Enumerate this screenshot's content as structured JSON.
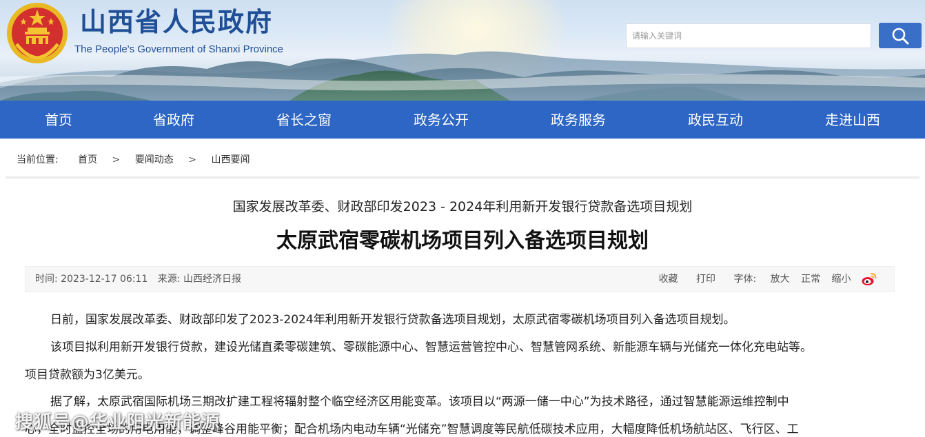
{
  "header": {
    "title": "山西省人民政府",
    "subtitle": "The People's Government of Shanxi Province",
    "search_placeholder": "请输入关键词"
  },
  "nav": {
    "items": [
      "首页",
      "省政府",
      "省长之窗",
      "政务公开",
      "政务服务",
      "政民互动",
      "走进山西"
    ]
  },
  "breadcrumb": {
    "label": "当前位置:",
    "items": [
      "首页",
      "要闻动态",
      "山西要闻"
    ],
    "separator": ">"
  },
  "article": {
    "subheadline": "国家发展改革委、财政部印发2023 - 2024年利用新开发银行贷款备选项目规划",
    "headline": "太原武宿零碳机场项目列入备选项目规划",
    "meta": {
      "time": "时间: 2023-12-17 06:11",
      "source": "来源: 山西经济日报",
      "favorite": "收藏",
      "print": "打印",
      "font_label": "字体:",
      "font_large": "放大",
      "font_normal": "正常",
      "font_small": "缩小"
    },
    "paragraphs": [
      "日前，国家发展改革委、财政部印发了2023-2024年利用新开发银行贷款备选项目规划，太原武宿零碳机场项目列入备选项目规划。",
      "该项目拟利用新开发银行贷款，建设光储直柔零碳建筑、零碳能源中心、智慧运营管控中心、智慧管网系统、新能源车辆与光储充一体化充电站等。",
      "项目贷款额为3亿美元。",
      "据了解，太原武宿国际机场三期改扩建工程将辐射整个临空经济区用能变革。该项目以“两源一储一中心”为技术路径，通过智慧能源运维控制中",
      "心，全时监控全场的用电用能，调整峰谷用能平衡；配合机场内电动车辆“光储充”智慧调度等民航低碳技术应用，大幅度降低机场航站区、飞行区、工"
    ]
  },
  "watermark": "搜狐号@华业阳光新能源",
  "colors": {
    "nav_bg": "#2d66c4",
    "title": "#1f4f96",
    "search_button": "#3a6fc7",
    "emblem_red": "#d32f2f",
    "emblem_gold": "#e8b923"
  }
}
